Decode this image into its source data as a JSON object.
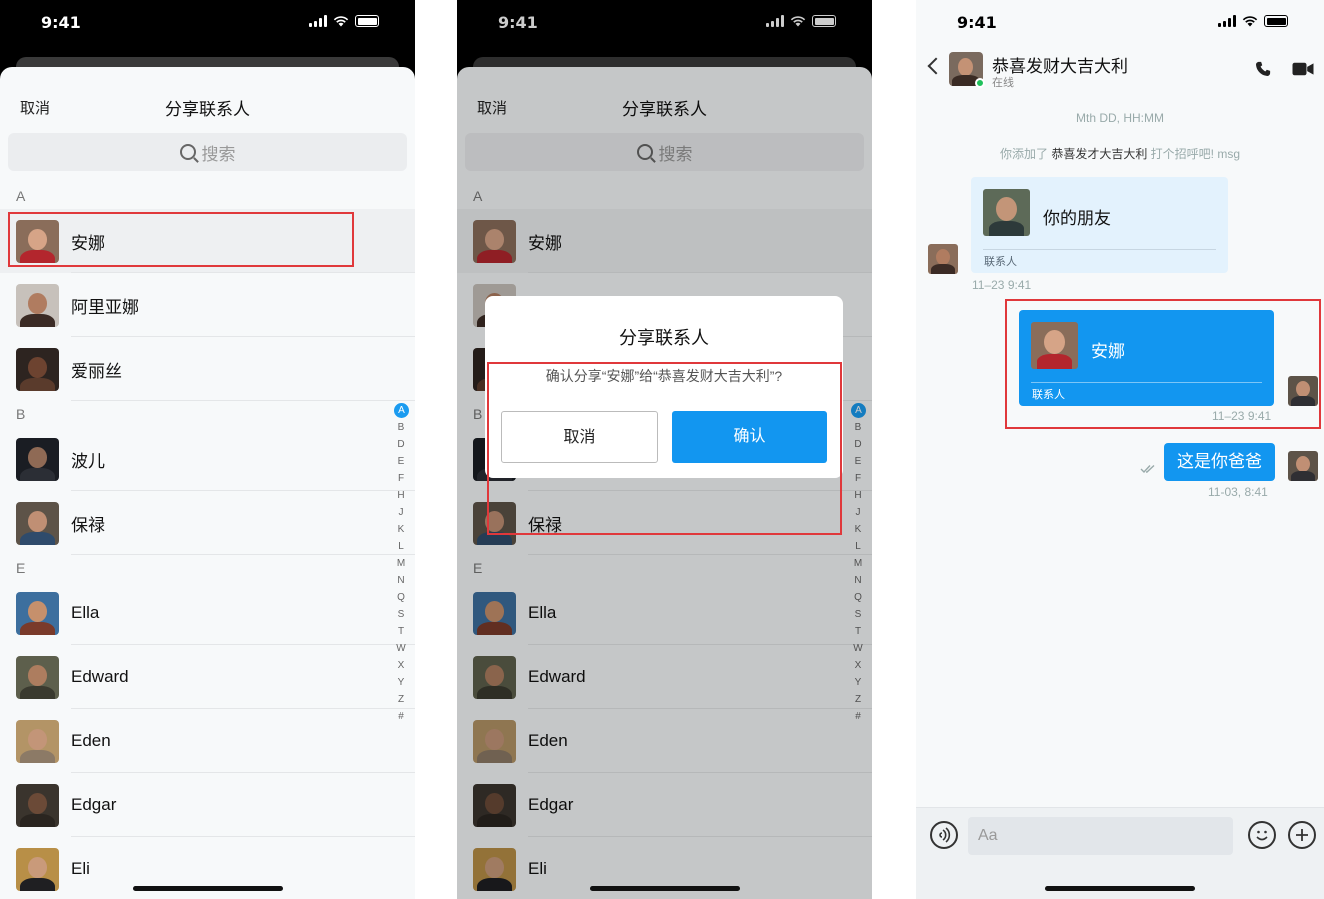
{
  "status": {
    "time": "9:41"
  },
  "sheet": {
    "cancel": "取消",
    "title": "分享联系人",
    "search_placeholder": "搜索"
  },
  "contacts": [
    {
      "type": "section",
      "label": "A"
    },
    {
      "type": "contact",
      "name": "安娜",
      "selected": true,
      "skin": "#d6a487",
      "cloth": "#b3262d",
      "bg": "#8a6d5a"
    },
    {
      "type": "contact",
      "name": "阿里亚娜",
      "skin": "#b07c60",
      "cloth": "#3b2b25",
      "bg": "#c7c1bb"
    },
    {
      "type": "contact",
      "name": "爱丽丝",
      "skin": "#6d4330",
      "cloth": "#5a3b2c",
      "bg": "#2d2420"
    },
    {
      "type": "section",
      "label": "B"
    },
    {
      "type": "contact",
      "name": "波儿",
      "skin": "#8f6a55",
      "cloth": "#2b2e35",
      "bg": "#1a1d23"
    },
    {
      "type": "contact",
      "name": "保禄",
      "skin": "#c08f74",
      "cloth": "#2f4b6b",
      "bg": "#5d5348"
    },
    {
      "type": "section",
      "label": "E"
    },
    {
      "type": "contact",
      "name": "Ella",
      "skin": "#c6906c",
      "cloth": "#7a3a2a",
      "bg": "#3d6f9e"
    },
    {
      "type": "contact",
      "name": "Edward",
      "skin": "#ad7d5f",
      "cloth": "#3a3a2f",
      "bg": "#5d5f4c"
    },
    {
      "type": "contact",
      "name": "Eden",
      "skin": "#c39578",
      "cloth": "#8c7a66",
      "bg": "#b39466"
    },
    {
      "type": "contact",
      "name": "Edgar",
      "skin": "#6b4a37",
      "cloth": "#2a2520",
      "bg": "#3a342d"
    },
    {
      "type": "contact",
      "name": "Eli",
      "skin": "#c99a7a",
      "cloth": "#1f1f22",
      "bg": "#b88f47",
      "last": true
    }
  ],
  "index_letters": [
    "A",
    "B",
    "D",
    "E",
    "F",
    "H",
    "J",
    "K",
    "L",
    "M",
    "N",
    "Q",
    "S",
    "T",
    "W",
    "X",
    "Y",
    "Z",
    "#"
  ],
  "dialog": {
    "title": "分享联系人",
    "message": "确认分享“安娜”给“恭喜发财大吉大利”?",
    "cancel": "取消",
    "confirm": "确认"
  },
  "chat": {
    "name": "恭喜发财大吉大利",
    "status": "在线",
    "date_stamp": "Mth DD, HH:MM",
    "system_prefix": "你添加了",
    "system_name": "恭喜发才大吉大利",
    "system_suffix": "打个招呼吧!",
    "system_tag": "msg",
    "friend_card": {
      "name": "你的朋友",
      "label": "联系人",
      "time": "11–23 9:41"
    },
    "my_card": {
      "name": "安娜",
      "label": "联系人",
      "time": "11–23 9:41"
    },
    "text_message": {
      "text": "这是你爸爸",
      "time": "11-03, 8:41"
    },
    "input_placeholder": "Aa"
  },
  "colors": {
    "accent": "#1296f0",
    "highlight": "#e0383b",
    "online": "#20c15c"
  }
}
